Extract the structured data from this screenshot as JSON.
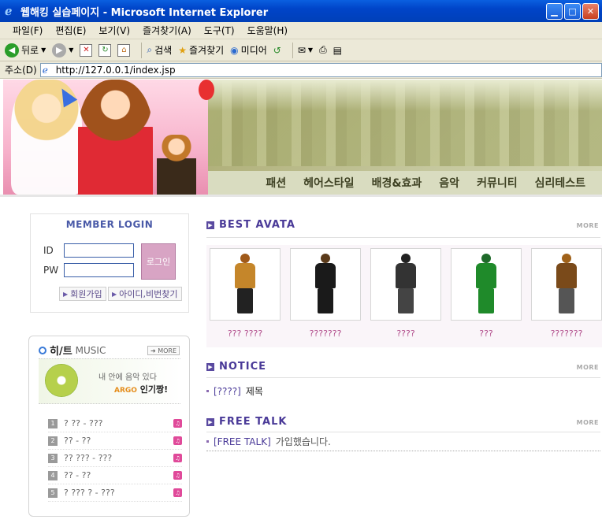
{
  "window": {
    "title": "웹해킹 실습페이지 - Microsoft Internet Explorer"
  },
  "menu": [
    "파일(F)",
    "편집(E)",
    "보기(V)",
    "즐겨찾기(A)",
    "도구(T)",
    "도움말(H)"
  ],
  "toolbar": {
    "back": "뒤로",
    "search": "검색",
    "favorites": "즐겨찾기",
    "media": "미디어"
  },
  "address": {
    "label": "주소(D)",
    "url": "http://127.0.0.1/index.jsp"
  },
  "nav": [
    "패션",
    "헤어스타일",
    "배경&효과",
    "음악",
    "커뮤니티",
    "심리테스트"
  ],
  "login": {
    "title": "MEMBER LOGIN",
    "id_label": "ID",
    "pw_label": "PW",
    "button": "로그인",
    "join": "회원가입",
    "find": "아이디,비번찾기"
  },
  "music": {
    "title_main": "히/트",
    "title_sub": "MUSIC",
    "more": "MORE",
    "banner_line1": "내 안에 음악 있다",
    "banner_brand": "ARGO",
    "banner_line2": "인기짱!",
    "items": [
      {
        "num": "1",
        "song": "? ?? - ???"
      },
      {
        "num": "2",
        "song": "?? - ??"
      },
      {
        "num": "3",
        "song": "?? ??? - ???"
      },
      {
        "num": "4",
        "song": "?? - ??"
      },
      {
        "num": "5",
        "song": "? ??? ? - ???"
      }
    ]
  },
  "best": {
    "title": "BEST AVATA",
    "more": "MORE",
    "items": [
      {
        "name": "??? ????",
        "body": "#c5862a",
        "legs": "#222222",
        "head": "#a05a1a"
      },
      {
        "name": "???????",
        "body": "#1a1a1a",
        "legs": "#1a1a1a",
        "head": "#5a3a1a"
      },
      {
        "name": "????",
        "body": "#333333",
        "legs": "#444444",
        "head": "#222222"
      },
      {
        "name": "???",
        "body": "#1f8a2a",
        "legs": "#1f8a2a",
        "head": "#1f6a2a"
      },
      {
        "name": "???????",
        "body": "#7a4a1a",
        "legs": "#555555",
        "head": "#a0621a"
      }
    ]
  },
  "notice": {
    "title": "NOTICE",
    "more": "MORE",
    "tag": "[????]",
    "text": "제목"
  },
  "freetalk": {
    "title": "FREE TALK",
    "more": "MORE",
    "tag": "[FREE TALK]",
    "text": "가입했습니다."
  }
}
